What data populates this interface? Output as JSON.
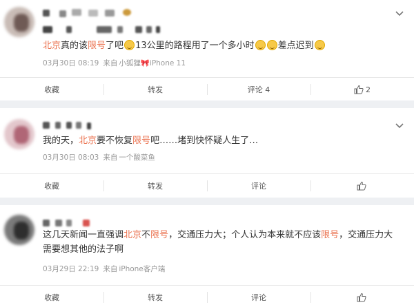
{
  "posts": [
    {
      "text_parts": [
        "北京",
        "真的该",
        "限号",
        "了吧",
        "13公里的路程用了一个多小时",
        "差点迟到"
      ],
      "time": "03月30日 08:19",
      "from": "来自",
      "source": "小狐狸",
      "device": "iPhone 11",
      "actions": {
        "save": "收藏",
        "repost": "转发",
        "comment": "评论 4",
        "like": "2"
      }
    },
    {
      "text_parts": [
        "我的天，",
        "北京",
        "要不恢复",
        "限号",
        "吧……堵到快怀疑人生了…"
      ],
      "time": "03月30日 08:03",
      "from": "来自",
      "source": "一个酸菜鱼",
      "actions": {
        "save": "收藏",
        "repost": "转发",
        "comment": "评论",
        "like": ""
      }
    },
    {
      "text_parts": [
        "这几天新闻一直强调",
        "北京",
        "不",
        "限号",
        "，交通压力大；个人认为本来就不应该",
        "限号",
        "，交通压力大需要想其他的法子啊"
      ],
      "time": "03月29日 22:19",
      "from": "来自",
      "source": "iPhone客户端",
      "actions": {
        "save": "收藏",
        "repost": "转发",
        "comment": "评论",
        "like": ""
      }
    }
  ],
  "colors": {
    "highlight": "#eb7350",
    "meta": "#999999",
    "action": "#555555"
  },
  "icons": {
    "menu": "chevron-down-icon",
    "like": "thumbs-up-icon",
    "emoji": "smile-emoji-icon"
  }
}
